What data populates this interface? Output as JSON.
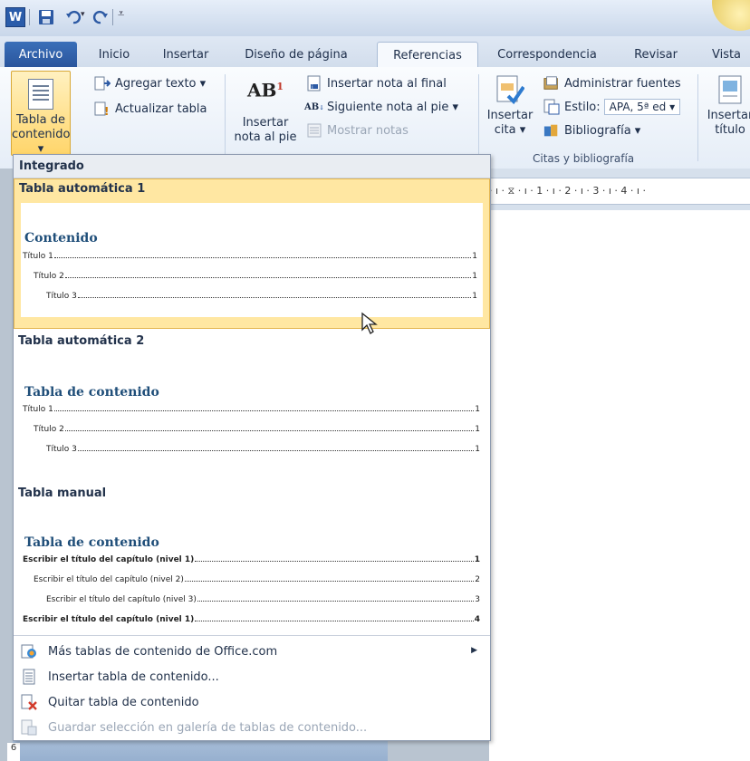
{
  "title_bar": {
    "app_icon_letter": "W",
    "icons": [
      "save-icon",
      "undo-icon",
      "redo-icon",
      "customize-qat-icon"
    ]
  },
  "tabs": [
    {
      "label": "Archivo",
      "active": false
    },
    {
      "label": "Inicio",
      "active": false
    },
    {
      "label": "Insertar",
      "active": false
    },
    {
      "label": "Diseño de página",
      "active": false
    },
    {
      "label": "Referencias",
      "active": true
    },
    {
      "label": "Correspondencia",
      "active": false
    },
    {
      "label": "Revisar",
      "active": false
    },
    {
      "label": "Vista",
      "active": false
    }
  ],
  "ribbon": {
    "toc_button": {
      "line1": "Tabla de",
      "line2": "contenido ▾"
    },
    "add_text": "Agregar texto ▾",
    "update_table": "Actualizar tabla",
    "insert_footnote": {
      "icon_text": "AB",
      "sup": "1",
      "line1": "Insertar",
      "line2": "nota al pie"
    },
    "insert_endnote": "Insertar nota al final",
    "next_footnote": "Siguiente nota al pie ▾",
    "show_notes": "Mostrar notas",
    "insert_citation": {
      "line1": "Insertar",
      "line2": "cita ▾"
    },
    "manage_sources": "Administrar fuentes",
    "style_label": "Estilo:",
    "style_value": "APA, 5ª ed ▾",
    "bibliography": "Bibliografía ▾",
    "citations_group_label": "Citas y bibliografía",
    "insert_caption": {
      "line1": "Insertar",
      "line2": "título"
    }
  },
  "ruler_text": "· ı · ⧖ · ı · 1 · ı · 2 · ı · 3 · ı · 4 · ı ·",
  "vertical_ruler": "6",
  "gallery": {
    "header": "Integrado",
    "entries": [
      {
        "name": "Tabla automática 1",
        "toc_title": "Contenido",
        "lines": [
          {
            "label": "Título 1",
            "page": "1"
          },
          {
            "label": "Título 2",
            "page": "1"
          },
          {
            "label": "Título 3",
            "page": "1"
          }
        ]
      },
      {
        "name": "Tabla automática 2",
        "toc_title": "Tabla de contenido",
        "lines": [
          {
            "label": "Título 1",
            "page": "1"
          },
          {
            "label": "Título 2",
            "page": "1"
          },
          {
            "label": "Título 3",
            "page": "1"
          }
        ]
      },
      {
        "name": "Tabla manual",
        "toc_title": "Tabla de contenido",
        "lines": [
          {
            "label": "Escribir el título del capítulo (nivel 1)",
            "page": "1"
          },
          {
            "label": "Escribir el título del capítulo (nivel 2)",
            "page": "2"
          },
          {
            "label": "Escribir el título del capítulo (nivel 3)",
            "page": "3"
          },
          {
            "label": "Escribir el título del capítulo (nivel 1)",
            "page": "4"
          }
        ]
      }
    ],
    "commands": [
      {
        "label": "Más tablas de contenido de Office.com",
        "enabled": true,
        "has_submenu": true
      },
      {
        "label": "Insertar tabla de contenido...",
        "enabled": true,
        "has_submenu": false
      },
      {
        "label": "Quitar tabla de contenido",
        "enabled": true,
        "has_submenu": false
      },
      {
        "label": "Guardar selección en galería de tablas de contenido...",
        "enabled": false,
        "has_submenu": false
      }
    ]
  },
  "colors": {
    "file_tab": "#2a559c",
    "highlight": "#ffe7a2",
    "toc_title": "#1f4e79"
  }
}
